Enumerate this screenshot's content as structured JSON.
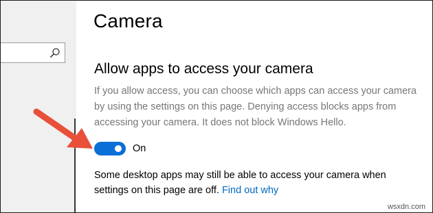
{
  "page": {
    "title": "Camera"
  },
  "section": {
    "heading": "Allow apps to access your camera",
    "description": "If you allow access, you can choose which apps can access your camera by using the settings on this page. Denying access blocks apps from accessing your camera. It does not block Windows Hello."
  },
  "toggle": {
    "state": "On",
    "is_on": true,
    "color": "#0a6fd6"
  },
  "note": {
    "text": "Some desktop apps may still be able to access your camera when settings on this page are off.",
    "link_label": "Find out why"
  },
  "search": {
    "icon": "search-icon"
  },
  "annotation": {
    "arrow_color": "#e8503a"
  },
  "watermark": {
    "text": "wsxdn.com"
  }
}
